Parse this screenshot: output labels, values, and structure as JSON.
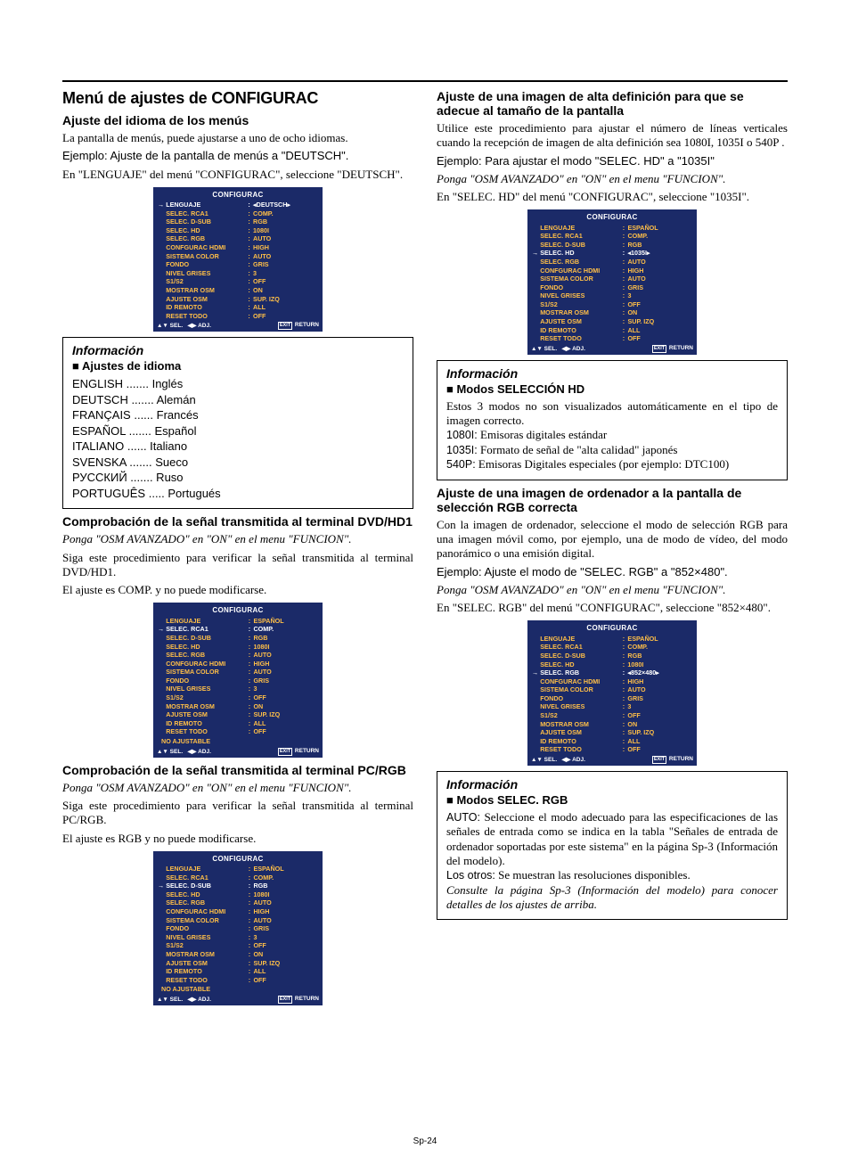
{
  "page_number": "Sp-24",
  "osd_common": {
    "title": "CONFIGURAC",
    "footer_sel": "SEL.",
    "footer_adj": "ADJ.",
    "footer_exit": "EXIT",
    "footer_return": "RETURN",
    "no_adjustable": "NO AJUSTABLE"
  },
  "osd_rows_labels": [
    "LENGUAJE",
    "SELEC. RCA1",
    "SELEC. D-SUB",
    "SELEC. HD",
    "SELEC. RGB",
    "CONFGURAC HDMI",
    "SISTEMA COLOR",
    "FONDO",
    "NIVEL GRISES",
    "S1/S2",
    "MOSTRAR OSM",
    "AJUSTE OSM",
    "ID REMOTO",
    "RESET TODO"
  ],
  "left": {
    "h1": "Menú de ajustes de CONFIGURAC",
    "sec1": {
      "h2": "Ajuste del idioma de los menús",
      "p1": "La pantalla de menús, puede ajustarse a uno de ocho idiomas.",
      "ex": "Ejemplo: Ajuste de la pantalla de menús a \"DEUTSCH\".",
      "p2": "En \"LENGUAJE\" del menú \"CONFIGURAC\", seleccione \"DEUTSCH\".",
      "osd_values": [
        "DEUTSCH",
        "COMP.",
        "RGB",
        "1080I",
        "AUTO",
        "HIGH",
        "AUTO",
        "GRIS",
        "3",
        "OFF",
        "ON",
        "SUP. IZQ",
        "ALL",
        "OFF"
      ],
      "osd_highlight": 0,
      "osd_arrows": 0
    },
    "info1": {
      "title": "Información",
      "sub": "Ajustes de idioma",
      "list": [
        [
          "ENGLISH",
          "Inglés"
        ],
        [
          "DEUTSCH",
          "Alemán"
        ],
        [
          "FRANÇAIS",
          "Francés"
        ],
        [
          "ESPAÑOL",
          "Español"
        ],
        [
          "ITALIANO",
          "Italiano"
        ],
        [
          "SVENSKA",
          "Sueco"
        ],
        [
          "РУССКИЙ",
          "Ruso"
        ],
        [
          "PORTUGUÊS",
          "Portugués"
        ]
      ]
    },
    "sec2": {
      "h2": "Comprobación de la señal transmitida al terminal DVD/HD1",
      "hint": "Ponga \"OSM AVANZADO\" en \"ON\" en el menu \"FUNCION\".",
      "p1": "Siga este procedimiento para verificar la señal transmitida al terminal DVD/HD1.",
      "p2": "El ajuste es COMP. y no puede modificarse.",
      "osd_values": [
        "ESPAÑOL",
        "COMP.",
        "RGB",
        "1080I",
        "AUTO",
        "HIGH",
        "AUTO",
        "GRIS",
        "3",
        "OFF",
        "ON",
        "SUP. IZQ",
        "ALL",
        "OFF"
      ],
      "osd_highlight": 1,
      "osd_noadj": true
    },
    "sec3": {
      "h2": "Comprobación de la señal transmitida al terminal PC/RGB",
      "hint": "Ponga \"OSM AVANZADO\" en \"ON\" en el menu \"FUNCION\".",
      "p1": "Siga este procedimiento para verificar la señal transmitida al terminal PC/RGB.",
      "p2": "El ajuste es RGB y no puede modificarse.",
      "osd_values": [
        "ESPAÑOL",
        "COMP.",
        "RGB",
        "1080I",
        "AUTO",
        "HIGH",
        "AUTO",
        "GRIS",
        "3",
        "OFF",
        "ON",
        "SUP. IZQ",
        "ALL",
        "OFF"
      ],
      "osd_highlight": 2,
      "osd_noadj": true
    }
  },
  "right": {
    "sec1": {
      "h2": "Ajuste de una imagen de alta definición para que se adecue al tamaño de la pantalla",
      "p1": "Utilice este procedimiento para ajustar el número de líneas verticales cuando la recepción de imagen de alta definición sea 1080I, 1035I o 540P .",
      "ex": "Ejemplo: Para ajustar el modo \"SELEC. HD\" a \"1035I\"",
      "hint": "Ponga \"OSM AVANZADO\" en \"ON\" en el menu \"FUNCION\".",
      "p2": "En \"SELEC. HD\" del menú \"CONFIGURAC\", seleccione \"1035I\".",
      "osd_values": [
        "ESPAÑOL",
        "COMP.",
        "RGB",
        "1035I",
        "AUTO",
        "HIGH",
        "AUTO",
        "GRIS",
        "3",
        "OFF",
        "ON",
        "SUP. IZQ",
        "ALL",
        "OFF"
      ],
      "osd_highlight": 3,
      "osd_arrows": 3
    },
    "info1": {
      "title": "Información",
      "sub": "Modos SELECCIÓN HD",
      "intro": "Estos 3 modos no son visualizados automáticamente en el tipo de imagen correcto.",
      "l1080i": "1080I:",
      "l1080i_t": "Emisoras digitales estándar",
      "l1035i": "1035I:",
      "l1035i_t": "Formato de señal de \"alta calidad\" japonés",
      "l540p": "540P:",
      "l540p_t": "Emisoras Digitales especiales (por ejemplo: DTC100)"
    },
    "sec2": {
      "h2": "Ajuste de una imagen de ordenador a la pantalla de selección RGB correcta",
      "p1": "Con la imagen de ordenador, seleccione el modo de selección RGB para una imagen móvil como, por ejemplo, una de modo de vídeo, del modo panorámico o una emisión digital.",
      "ex": "Ejemplo: Ajuste el modo de \"SELEC. RGB\" a \"852×480\".",
      "hint": "Ponga \"OSM AVANZADO\" en \"ON\" en el menu \"FUNCION\".",
      "p2": "En \"SELEC. RGB\" del menú \"CONFIGURAC\", seleccione \"852×480\".",
      "osd_values": [
        "ESPAÑOL",
        "COMP.",
        "RGB",
        "1080I",
        "852×480",
        "HIGH",
        "AUTO",
        "GRIS",
        "3",
        "OFF",
        "ON",
        "SUP. IZQ",
        "ALL",
        "OFF"
      ],
      "osd_highlight": 4,
      "osd_arrows": 4
    },
    "info2": {
      "title": "Información",
      "sub": "Modos SELEC. RGB",
      "auto_lbl": "AUTO:",
      "auto_t": "Seleccione el modo adecuado para las especificaciones de las señales de entrada como se indica en la tabla \"Señales de entrada de ordenador soportadas por este sistema\" en la página Sp-3 (Información del modelo).",
      "otros_lbl": "Los otros:",
      "otros_t": "Se muestran las resoluciones disponibles.",
      "note": "Consulte la página Sp-3 (Información del modelo) para conocer detalles de los ajustes de arriba."
    }
  }
}
